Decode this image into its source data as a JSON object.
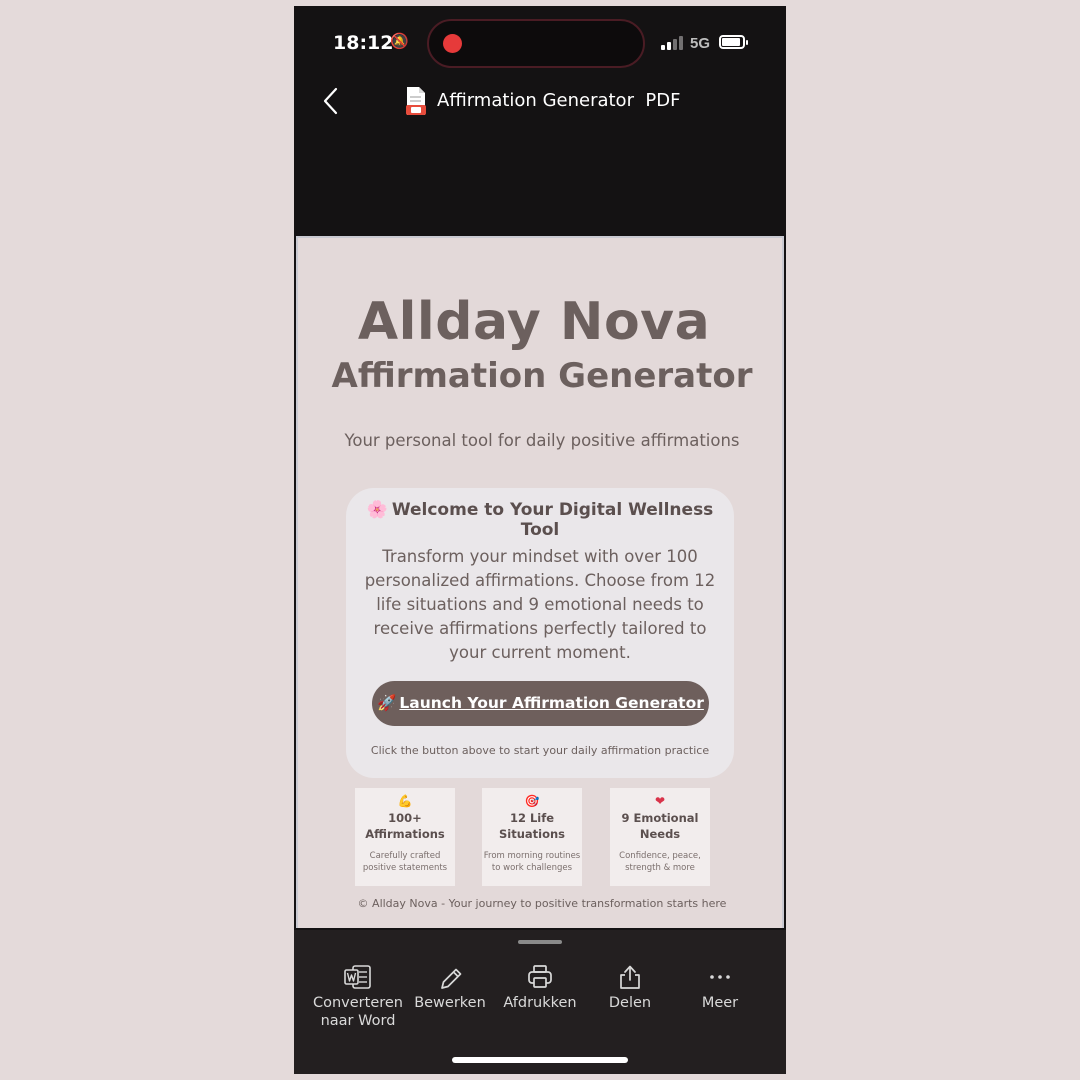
{
  "status": {
    "time": "18:12",
    "network": "5G"
  },
  "nav": {
    "title": "Affirmation Generator  PDF"
  },
  "doc": {
    "title": "Allday Nova",
    "subtitle": "Affirmation Generator",
    "tagline": "Your personal tool for daily positive affirmations",
    "card": {
      "emoji": "🌸",
      "title": "Welcome to Your Digital Wellness Tool",
      "body": "Transform your mindset with over 100 personalized affirmations. Choose from 12 life situations and 9 emotional needs to receive affirmations perfectly tailored to your current moment.",
      "button_emoji": "🚀",
      "button_label": "Launch Your Affirmation Generator",
      "hint": "Click the button above to start your daily affirmation practice"
    },
    "features": [
      {
        "emoji": "💪",
        "title": "100+ Affirmations",
        "desc": "Carefully crafted positive statements"
      },
      {
        "emoji": "🎯",
        "title": "12 Life Situations",
        "desc": "From morning routines to work challenges"
      },
      {
        "emoji": "❤",
        "title": "9 Emotional Needs",
        "desc": "Confidence, peace, strength & more"
      }
    ],
    "footer": "© Allday Nova - Your journey to positive transformation starts here"
  },
  "toolbar": {
    "items": [
      {
        "label": "Converteren naar Word",
        "icon": "word-icon"
      },
      {
        "label": "Bewerken",
        "icon": "pencil-icon"
      },
      {
        "label": "Afdrukken",
        "icon": "printer-icon"
      },
      {
        "label": "Delen",
        "icon": "share-icon"
      },
      {
        "label": "Meer",
        "icon": "more-icon"
      }
    ]
  },
  "colors": {
    "accent": "#6e5f5c",
    "text": "#6c605e",
    "background": "#e4dada",
    "record": "#e63a3a"
  }
}
